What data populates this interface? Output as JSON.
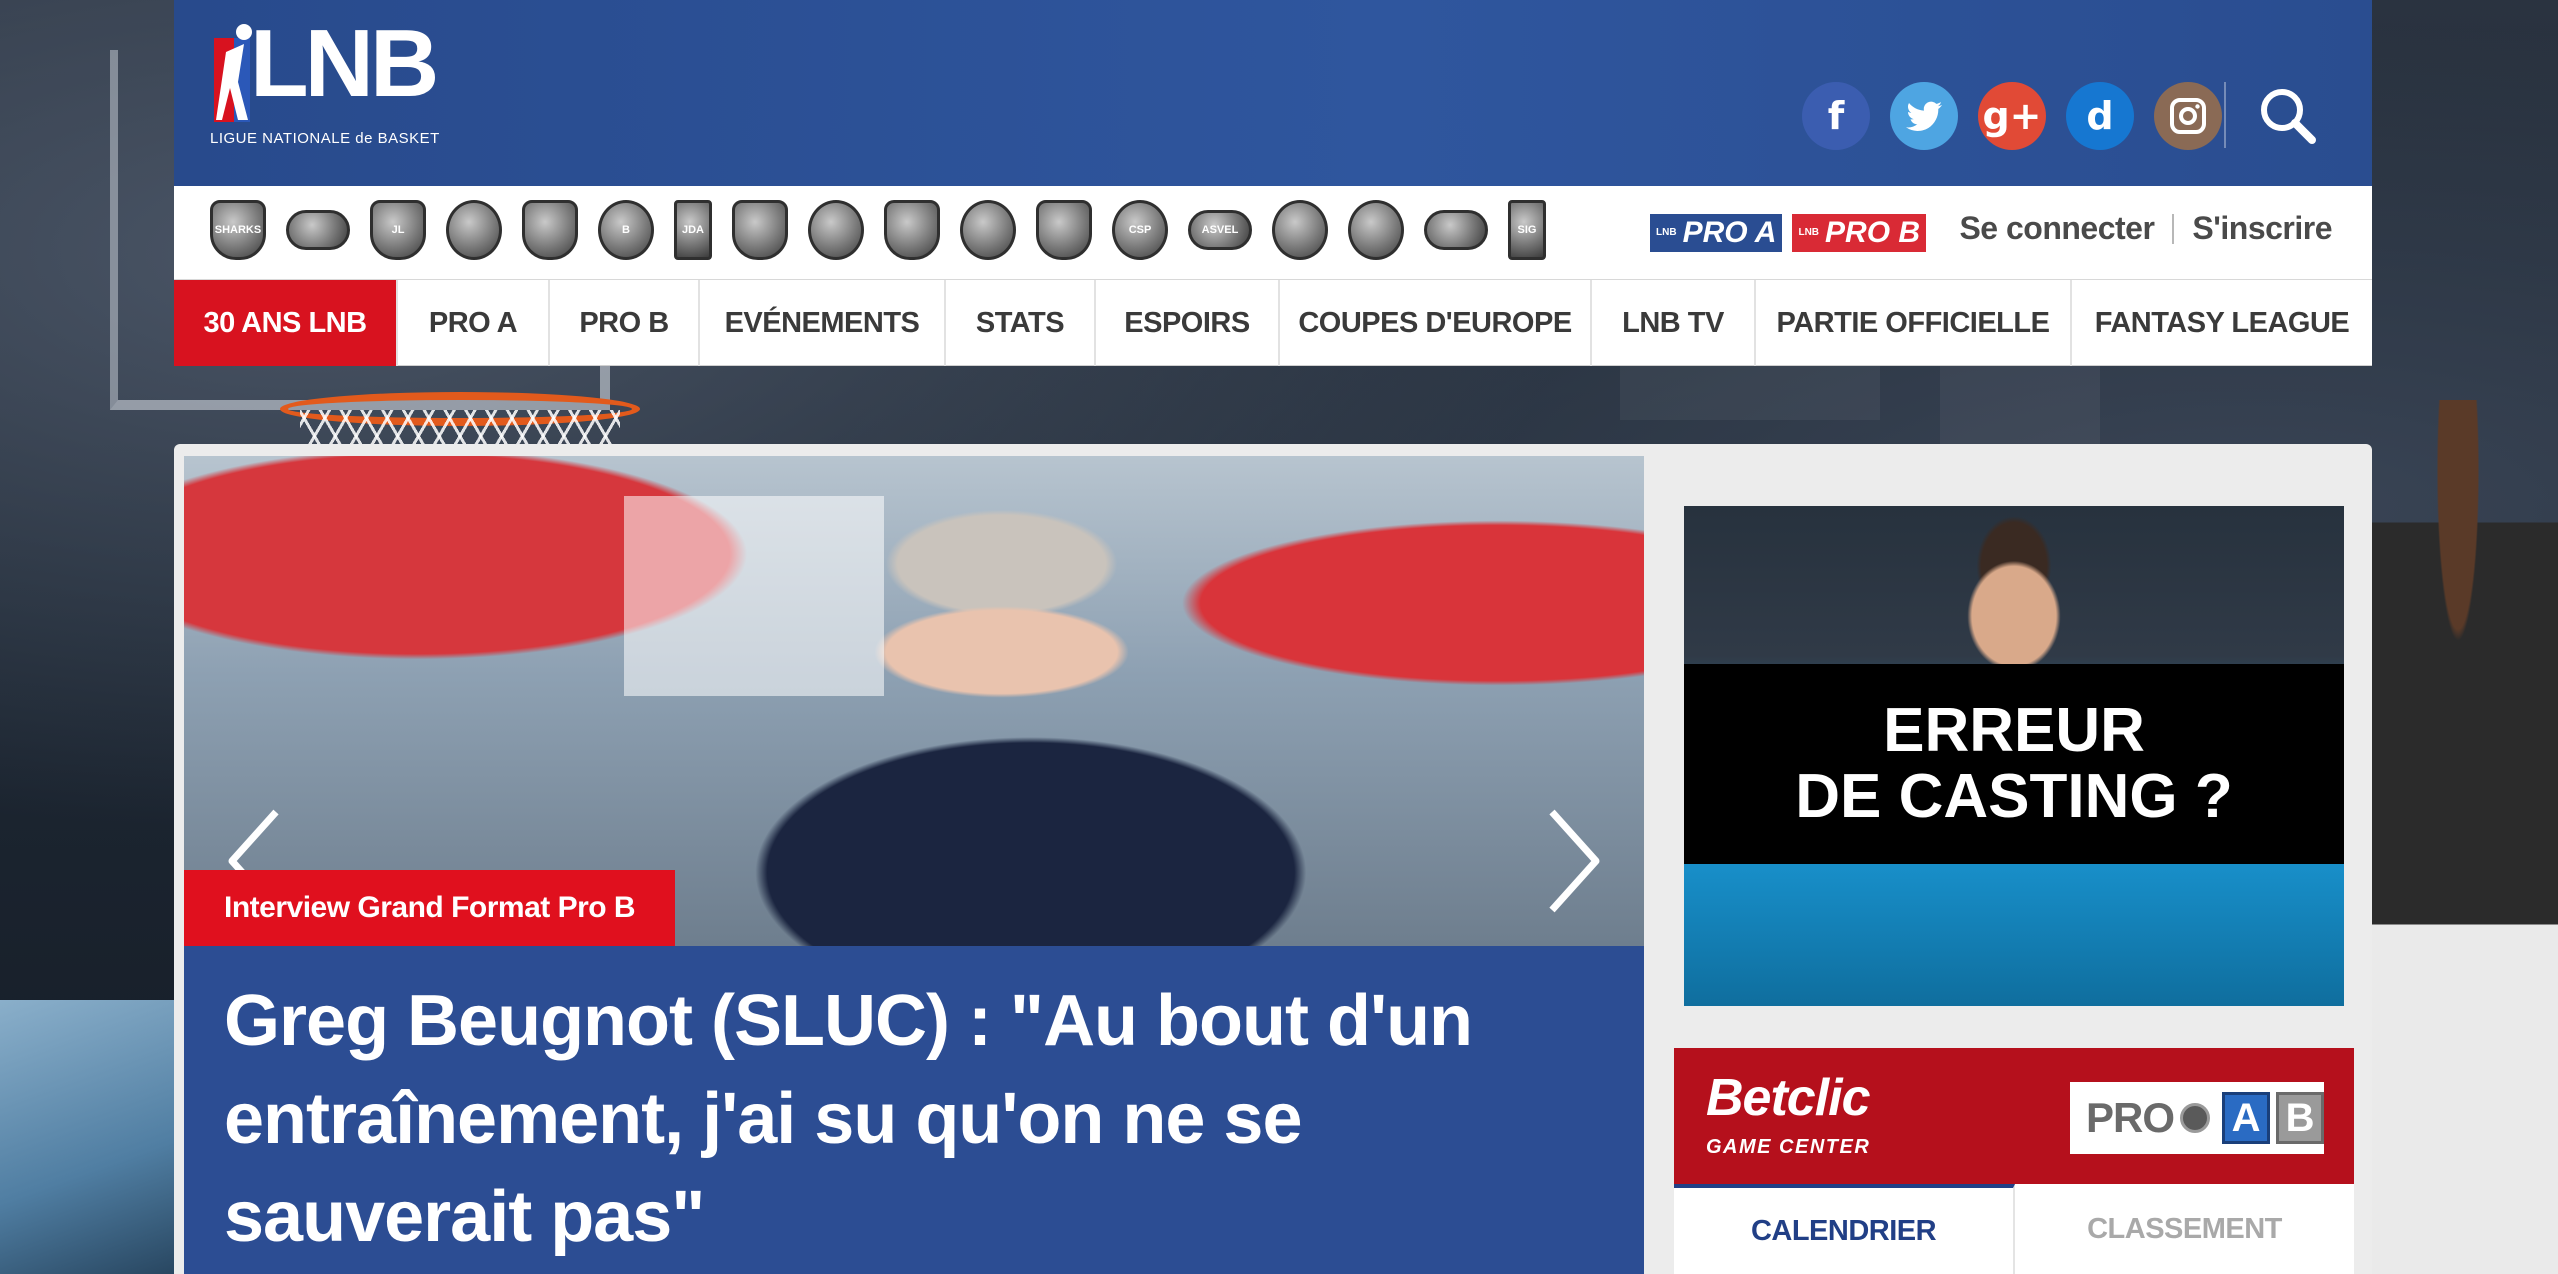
{
  "brand": {
    "logo_text": "LNB",
    "logo_sub": "LIGUE NATIONALE de BASKET",
    "colors": {
      "blue": "#2c4d93",
      "red": "#d8121f",
      "dark_red": "#b5101c"
    }
  },
  "header": {
    "social": [
      {
        "name": "facebook",
        "glyph": "f"
      },
      {
        "name": "twitter",
        "glyph": "t"
      },
      {
        "name": "google-plus",
        "glyph": "g+"
      },
      {
        "name": "dailymotion",
        "glyph": "d"
      },
      {
        "name": "instagram",
        "glyph": "◎"
      }
    ],
    "search_icon": "search-icon"
  },
  "teams": [
    {
      "name": "SHARKS",
      "shape": "shield"
    },
    {
      "name": "",
      "shape": "wide"
    },
    {
      "name": "JL",
      "shape": "shield"
    },
    {
      "name": "",
      "shape": "circle"
    },
    {
      "name": "",
      "shape": "shield"
    },
    {
      "name": "B",
      "shape": "circle"
    },
    {
      "name": "JDA",
      "shape": "rect"
    },
    {
      "name": "",
      "shape": "shield"
    },
    {
      "name": "",
      "shape": "circle"
    },
    {
      "name": "",
      "shape": "shield"
    },
    {
      "name": "",
      "shape": "circle"
    },
    {
      "name": "",
      "shape": "shield"
    },
    {
      "name": "CSP",
      "shape": "circle"
    },
    {
      "name": "ASVEL",
      "shape": "wide"
    },
    {
      "name": "",
      "shape": "circle"
    },
    {
      "name": "",
      "shape": "circle"
    },
    {
      "name": "",
      "shape": "wide"
    },
    {
      "name": "SIG",
      "shape": "rect"
    }
  ],
  "leagues": {
    "lnb_small": "LNB",
    "pro_a": "PRO A",
    "pro_b": "PRO B"
  },
  "auth": {
    "login": "Se connecter",
    "register": "S'inscrire"
  },
  "nav": [
    {
      "label": "30 ANS LNB",
      "active": true
    },
    {
      "label": "PRO A",
      "active": false
    },
    {
      "label": "PRO B",
      "active": false
    },
    {
      "label": "EVÉNEMENTS",
      "active": false
    },
    {
      "label": "STATS",
      "active": false
    },
    {
      "label": "ESPOIRS",
      "active": false
    },
    {
      "label": "COUPES D'EUROPE",
      "active": false
    },
    {
      "label": "LNB TV",
      "active": false
    },
    {
      "label": "PARTIE OFFICIELLE",
      "active": false
    },
    {
      "label": "FANTASY LEAGUE",
      "active": false
    }
  ],
  "hero": {
    "tag": "Interview Grand Format Pro B",
    "title": "Greg Beugnot (SLUC) : \"Au bout d'un entraînement, j'ai su qu'on ne se sauverait pas\""
  },
  "ad": {
    "line1": "ERREUR",
    "line2": "DE CASTING ?"
  },
  "game_center": {
    "brand": "Betclic",
    "sub": "GAME CENTER",
    "pro": "PRO",
    "a": "A",
    "b": "B"
  },
  "tabs": [
    {
      "label": "CALENDRIER",
      "active": true
    },
    {
      "label": "CLASSEMENT",
      "active": false
    }
  ]
}
